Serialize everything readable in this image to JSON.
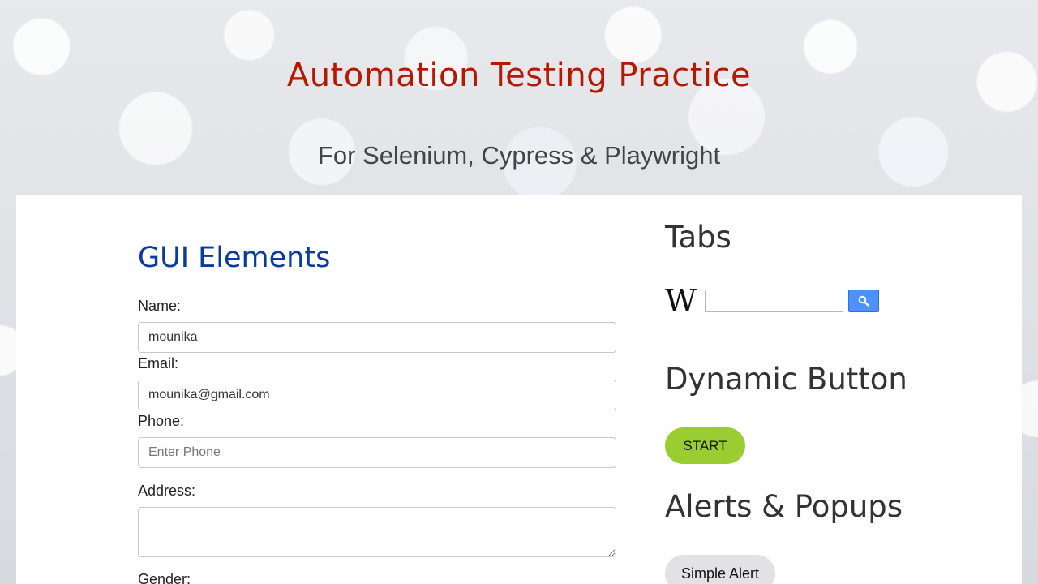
{
  "header": {
    "title": "Automation Testing Practice",
    "subtitle": "For Selenium, Cypress & Playwright"
  },
  "gui": {
    "title": "GUI Elements",
    "name_label": "Name:",
    "name_value": "mounika",
    "email_label": "Email:",
    "email_value": "mounika@gmail.com",
    "phone_label": "Phone:",
    "phone_placeholder": "Enter Phone",
    "address_label": "Address:",
    "address_value": "",
    "gender_label": "Gender:"
  },
  "tabs": {
    "title": "Tabs",
    "wiki_logo": "W",
    "search_value": ""
  },
  "dynamic": {
    "title": "Dynamic Button",
    "start_label": "START"
  },
  "alerts": {
    "title": "Alerts & Popups",
    "simple_alert_label": "Simple Alert"
  },
  "colors": {
    "site_title": "#b51a00",
    "section_title": "#0b3aa1",
    "start_button": "#9acd32",
    "search_button": "#4d90fe"
  },
  "icons": {
    "search_button_icon": "magnifier-icon",
    "wiki_logo_icon": "wikipedia-logo"
  }
}
